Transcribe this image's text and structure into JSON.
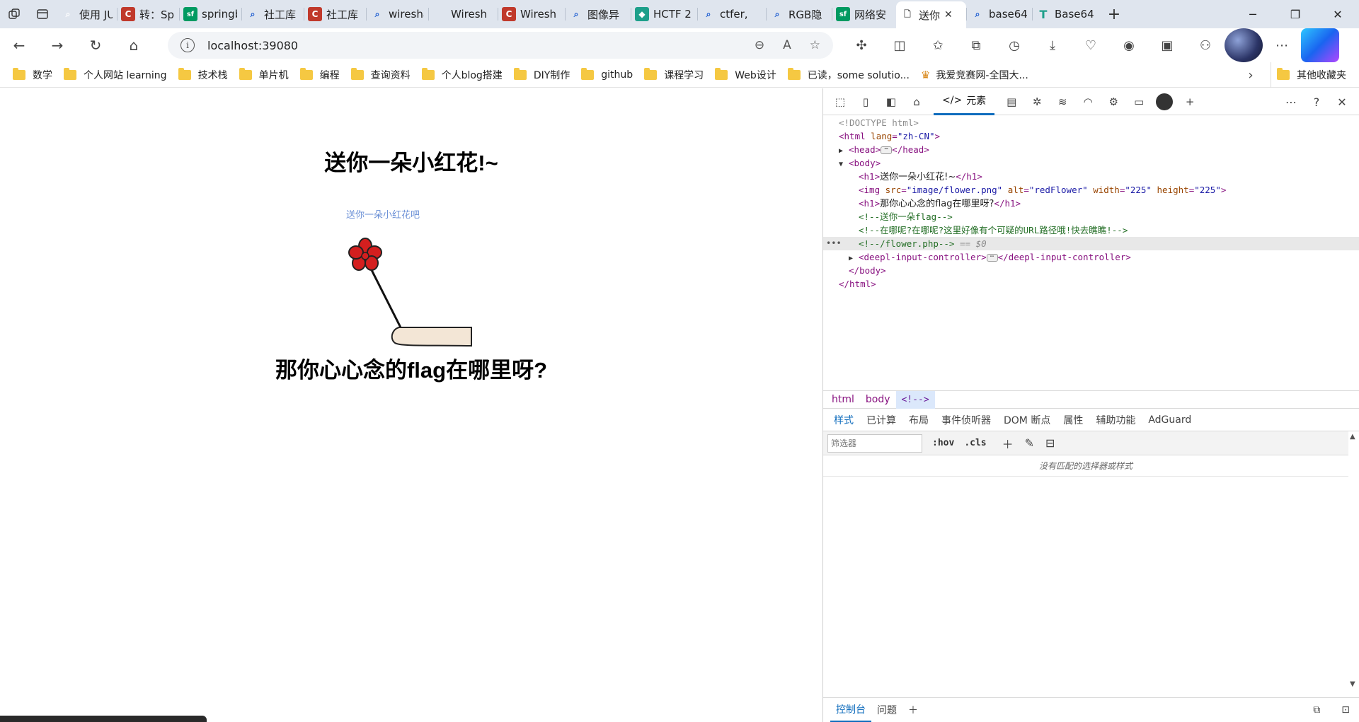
{
  "tabs": [
    {
      "title": "使用 JU",
      "fav": "search",
      "color": "#1a5bd1"
    },
    {
      "title": "转：Sp",
      "fav": "C",
      "color": "#c0392b"
    },
    {
      "title": "springb",
      "fav": "sf",
      "color": "#009a61"
    },
    {
      "title": "社工库",
      "fav": "search",
      "color": "#1a5bd1"
    },
    {
      "title": "社工库",
      "fav": "C",
      "color": "#c0392b"
    },
    {
      "title": "wiresha",
      "fav": "search",
      "color": "#1a5bd1"
    },
    {
      "title": "Wiresh",
      "fav": "blank",
      "color": "#777777"
    },
    {
      "title": "Wiresh",
      "fav": "C",
      "color": "#c0392b"
    },
    {
      "title": "图像异",
      "fav": "search",
      "color": "#1a5bd1"
    },
    {
      "title": "HCTF 2",
      "fav": "hex",
      "color": "#1d9f8a"
    },
    {
      "title": "ctfer, ",
      "fav": "search",
      "color": "#1a5bd1"
    },
    {
      "title": "RGB隐",
      "fav": "search",
      "color": "#1a5bd1"
    },
    {
      "title": "网络安",
      "fav": "sf",
      "color": "#009a61"
    },
    {
      "title": "送你",
      "fav": "page",
      "color": "#555555",
      "active": true
    },
    {
      "title": "base64",
      "fav": "search",
      "color": "#1a5bd1"
    },
    {
      "title": "Base64",
      "fav": "T",
      "color": "#1d9f8a"
    }
  ],
  "address": {
    "url": "localhost:39080"
  },
  "bookmarks": [
    "数学",
    "个人网站 learning",
    "技术栈",
    "单片机",
    "编程",
    "查询资料",
    "个人blog搭建",
    "DIY制作",
    "github",
    "课程学习",
    "Web设计",
    "已读，some solutio...",
    "我爱竞赛网-全国大..."
  ],
  "bookmarks_other": "其他收藏夹",
  "page": {
    "h1_top": "送你一朵小红花!~",
    "img_caption": "送你一朵小红花吧",
    "h1_bottom": "那你心心念的flag在哪里呀?"
  },
  "devtools": {
    "elements_tab": "元素",
    "dom": {
      "doctype": "<!DOCTYPE html>",
      "html_lang_attr": "lang",
      "html_lang_val": "\"zh-CN\"",
      "head": "head",
      "body": "body",
      "h1_1_text": "送你一朵小红花!~",
      "img_src": "\"image/flower.png\"",
      "img_alt": "\"redFlower\"",
      "img_width": "\"225\"",
      "img_height": "\"225\"",
      "h1_2_text": "那你心心念的flag在哪里呀?",
      "comment1": "<!--送你一朵flag-->",
      "comment2": "<!--在哪呢?在哪呢?这里好像有个可疑的URL路径哦!快去瞧瞧!-->",
      "comment3": "<!--/flower.php-->",
      "eq0": "== $0",
      "deepl": "deepl-input-controller"
    },
    "crumbs": [
      "html",
      "body",
      "<!-->"
    ],
    "style_tabs": [
      "样式",
      "已计算",
      "布局",
      "事件侦听器",
      "DOM 断点",
      "属性",
      "辅助功能",
      "AdGuard"
    ],
    "filter_placeholder": "筛选器",
    "hov": ":hov",
    "cls": ".cls",
    "no_match": "没有匹配的选择器或样式",
    "drawer_tabs": [
      "控制台",
      "问题"
    ]
  }
}
